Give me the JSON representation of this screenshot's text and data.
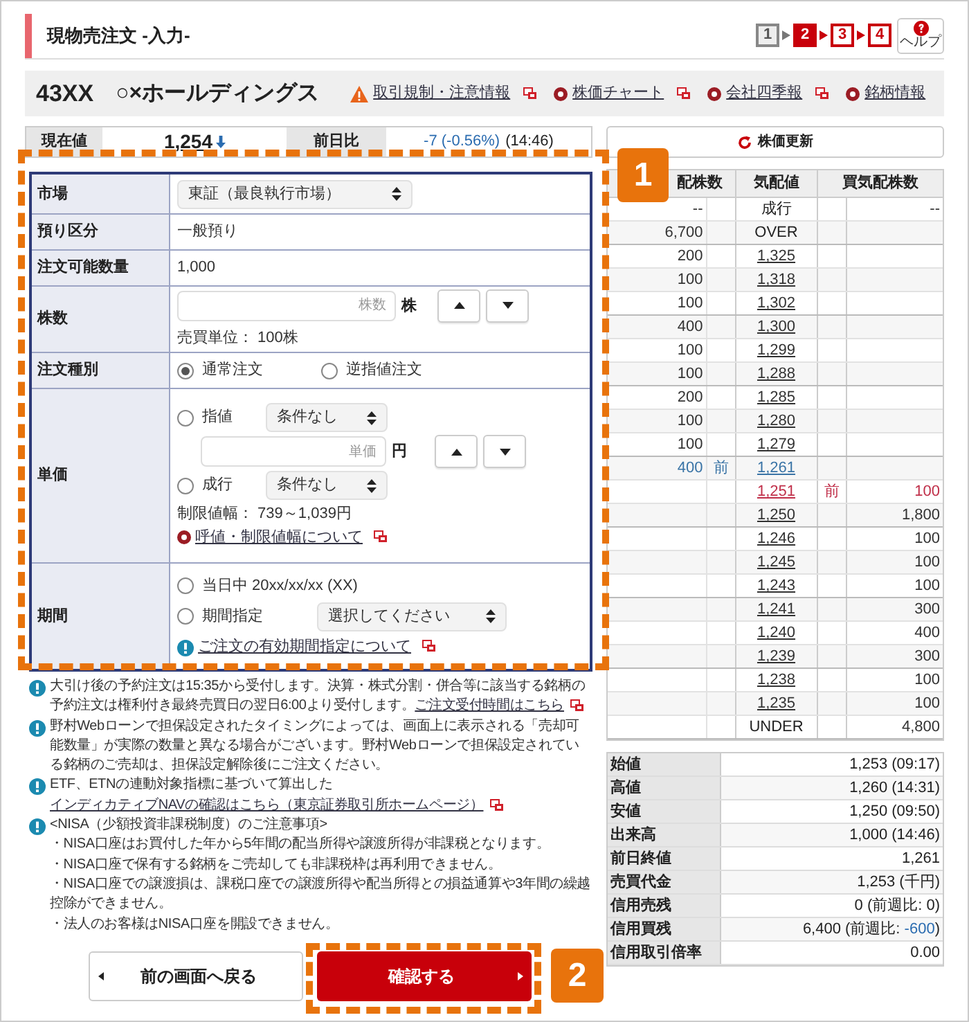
{
  "header": {
    "title": "現物売注文 -入力-",
    "steps": [
      {
        "label": "1",
        "selected": false
      },
      {
        "label": "2",
        "selected": true
      },
      {
        "label": "3",
        "selected": false
      },
      {
        "label": "4",
        "selected": false
      }
    ],
    "help": "ヘルプ"
  },
  "stock": {
    "code": "43XX",
    "name": "○×ホールディングス",
    "links": [
      {
        "label": "取引規制・注意情報",
        "kind": "warning"
      },
      {
        "label": "株価チャート",
        "kind": "bullet"
      },
      {
        "label": "会社四季報",
        "kind": "bullet"
      },
      {
        "label": "銘柄情報",
        "kind": "bullet"
      }
    ]
  },
  "quote": {
    "price_label": "現在値",
    "price": "1,254",
    "falling": true,
    "change_label": "前日比",
    "change": "-7 (-0.56%)",
    "time": "(14:46)",
    "refresh": "株価更新"
  },
  "form": [
    {
      "label": "市場",
      "kind": "select",
      "value": "東証（最良執行市場）"
    },
    {
      "label": "預り区分",
      "kind": "text",
      "value": "一般預り"
    },
    {
      "label": "注文可能数量",
      "kind": "text",
      "value": "1,000"
    },
    {
      "label": "株数",
      "kind": "quantity",
      "placeholder": "株数",
      "unit": "株",
      "note": "売買単位： 100株"
    },
    {
      "label": "注文種別",
      "kind": "radios",
      "options": [
        {
          "label": "通常注文",
          "selected": true
        },
        {
          "label": "逆指値注文",
          "selected": false
        }
      ]
    },
    {
      "label": "単価",
      "kind": "price",
      "limit": {
        "label": "指値",
        "selected": false,
        "condition": "条件なし",
        "placeholder": "単価",
        "unit": "円"
      },
      "market": {
        "label": "成行",
        "selected": false,
        "condition": "条件なし"
      },
      "note": "制限値幅： 739～1,039円",
      "link": "呼値・制限値幅について"
    },
    {
      "label": "期間",
      "kind": "period",
      "options": [
        {
          "label": "当日中 20xx/xx/xx (XX)",
          "selected": false
        },
        {
          "label": "期間指定",
          "selected": false,
          "select": "選択してください"
        }
      ],
      "link": "ご注文の有効期間指定について"
    }
  ],
  "notes": [
    {
      "text": "大引け後の予約注文は15:35から受付します。決算・株式分割・併合等に該当する銘柄の予約注文は権利付き最終売買日の翌日6:00より受付します。",
      "link": "ご注文受付時間はこちら"
    },
    {
      "text": "野村Webローンで担保設定されたタイミングによっては、画面上に表示される「売却可能数量」が実際の数量と異なる場合がございます。野村Webローンで担保設定されている銘柄のご売却は、担保設定解除後にご注文ください。"
    },
    {
      "text": "ETF、ETNの連動対象指標に基づいて算出した",
      "link": "インディカティブNAVの確認はこちら（東京証券取引所ホームページ）"
    },
    {
      "text": "<NISA（少額投資非課税制度）のご注意事項>",
      "items": [
        "・NISA口座はお買付した年から5年間の配当所得や譲渡所得が非課税となります。",
        "・NISA口座で保有する銘柄をご売却しても非課税枠は再利用できません。",
        "・NISA口座での譲渡損は、課税口座での譲渡所得や配当所得との損益通算や3年間の繰越控除ができません。",
        "・法人のお客様はNISA口座を開設できません。"
      ]
    }
  ],
  "buttons": {
    "back": "前の画面へ戻る",
    "confirm": "確認する"
  },
  "order_book": {
    "columns": [
      "配株数",
      "気配値",
      "買気配株数"
    ],
    "rows": [
      {
        "ask": "--",
        "price": "成行",
        "kind": "label",
        "bid": "--",
        "ask_prev": false,
        "bid_prev": false
      },
      {
        "ask": "6,700",
        "price": "OVER",
        "kind": "label",
        "ask_prev": false,
        "bid_prev": false
      },
      {
        "ask": "200",
        "price": "1,325",
        "kind": "price",
        "ask_prev": false,
        "bid_prev": false
      },
      {
        "ask": "100",
        "price": "1,318",
        "kind": "price",
        "ask_prev": false,
        "bid_prev": false
      },
      {
        "ask": "100",
        "price": "1,302",
        "kind": "price",
        "ask_prev": false,
        "bid_prev": false
      },
      {
        "ask": "400",
        "price": "1,300",
        "kind": "price",
        "ask_prev": false,
        "bid_prev": false
      },
      {
        "ask": "100",
        "price": "1,299",
        "kind": "price",
        "ask_prev": false,
        "bid_prev": false
      },
      {
        "ask": "100",
        "price": "1,288",
        "kind": "price",
        "ask_prev": false,
        "bid_prev": false
      },
      {
        "ask": "200",
        "price": "1,285",
        "kind": "price",
        "ask_prev": false,
        "bid_prev": false
      },
      {
        "ask": "100",
        "price": "1,280",
        "kind": "price",
        "ask_prev": false,
        "bid_prev": false
      },
      {
        "ask": "100",
        "price": "1,279",
        "kind": "price",
        "ask_prev": false,
        "bid_prev": false
      },
      {
        "ask": "400",
        "ask_mark": "前",
        "price": "1,261",
        "kind": "price",
        "ask_prev": true,
        "bid_prev": false
      },
      {
        "price": "1,251",
        "kind": "price",
        "bid_mark": "前",
        "bid": "100",
        "ask_prev": false,
        "bid_prev": true
      },
      {
        "price": "1,250",
        "kind": "price",
        "bid": "1,800",
        "ask_prev": false,
        "bid_prev": false
      },
      {
        "price": "1,246",
        "kind": "price",
        "bid": "100",
        "ask_prev": false,
        "bid_prev": false
      },
      {
        "price": "1,245",
        "kind": "price",
        "bid": "100",
        "ask_prev": false,
        "bid_prev": false
      },
      {
        "price": "1,243",
        "kind": "price",
        "bid": "100",
        "ask_prev": false,
        "bid_prev": false
      },
      {
        "price": "1,241",
        "kind": "price",
        "bid": "300",
        "ask_prev": false,
        "bid_prev": false
      },
      {
        "price": "1,240",
        "kind": "price",
        "bid": "400",
        "ask_prev": false,
        "bid_prev": false
      },
      {
        "price": "1,239",
        "kind": "price",
        "bid": "300",
        "ask_prev": false,
        "bid_prev": false
      },
      {
        "price": "1,238",
        "kind": "price",
        "bid": "100",
        "ask_prev": false,
        "bid_prev": false
      },
      {
        "price": "1,235",
        "kind": "price",
        "bid": "100",
        "ask_prev": false,
        "bid_prev": false
      },
      {
        "price": "UNDER",
        "kind": "label",
        "bid": "4,800",
        "ask_prev": false,
        "bid_prev": false
      }
    ]
  },
  "stats": [
    {
      "label": "始値",
      "value": "1,253 (09:17)"
    },
    {
      "label": "高値",
      "value": "1,260 (14:31)"
    },
    {
      "label": "安値",
      "value": "1,250 (09:50)"
    },
    {
      "label": "出来高",
      "value": "1,000 (14:46)"
    },
    {
      "label": "前日終値",
      "value": "1,261"
    },
    {
      "label": "売買代金",
      "value": "1,253 (千円)"
    },
    {
      "label": "信用売残",
      "value": "0 (前週比: 0)"
    },
    {
      "label": "信用買残",
      "value": "6,400 (前週比: ",
      "accent": "-600",
      "suffix": ")"
    },
    {
      "label": "信用取引倍率",
      "value": "0.00"
    }
  ],
  "annotations": [
    "1",
    "2"
  ]
}
